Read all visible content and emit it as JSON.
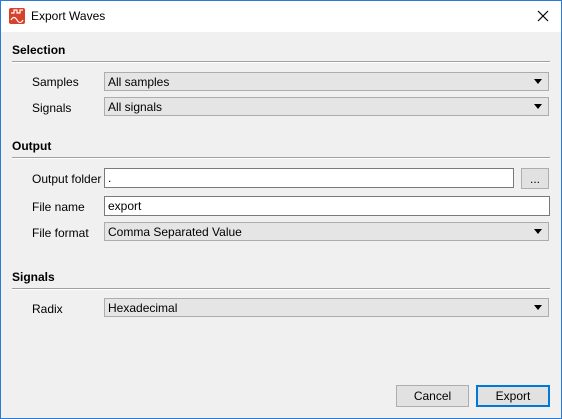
{
  "window": {
    "title": "Export Waves"
  },
  "sections": {
    "selection": {
      "title": "Selection",
      "samples_label": "Samples",
      "samples_value": "All samples",
      "signals_label": "Signals",
      "signals_value": "All signals"
    },
    "output": {
      "title": "Output",
      "folder_label": "Output folder",
      "folder_value": ".",
      "browse_label": "...",
      "filename_label": "File name",
      "filename_value": "export",
      "format_label": "File format",
      "format_value": "Comma Separated Value"
    },
    "signals": {
      "title": "Signals",
      "radix_label": "Radix",
      "radix_value": "Hexadecimal"
    }
  },
  "buttons": {
    "cancel": "Cancel",
    "export": "Export"
  },
  "icons": {
    "app": "app-icon",
    "close": "close-icon"
  }
}
